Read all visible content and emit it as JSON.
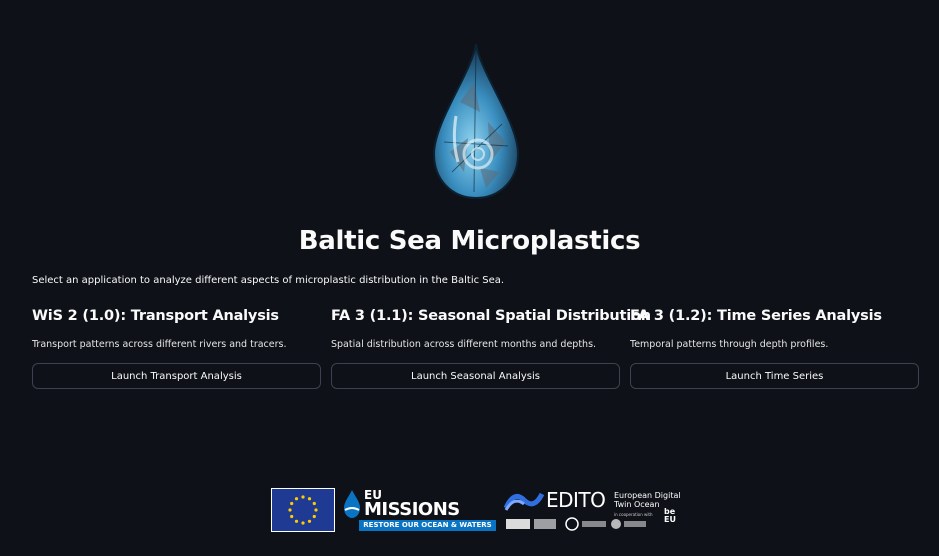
{
  "app": {
    "title": "Baltic Sea Microplastics",
    "intro": "Select an application to analyze different aspects of microplastic distribution in the Baltic Sea.",
    "hero_icon": "water-droplet-mosaic"
  },
  "apps": [
    {
      "heading": "WiS 2 (1.0): Transport Analysis",
      "description": "Transport patterns across different rivers and tracers.",
      "button": "Launch Transport Analysis"
    },
    {
      "heading": "FA 3 (1.1): Seasonal Spatial Distribution",
      "description": "Spatial distribution across different months and depths.",
      "button": "Launch Seasonal Analysis"
    },
    {
      "heading": "FA 3 (1.2): Time Series Analysis",
      "description": "Temporal patterns through depth profiles.",
      "button": "Launch Time Series"
    }
  ],
  "footer": {
    "missions_eu": "EU",
    "missions_word": "MISSIONS",
    "missions_tagline": "RESTORE OUR OCEAN & WATERS",
    "edito_word": "EDITO",
    "edito_sub1": "European Digital",
    "edito_sub2": "Twin Ocean",
    "edito_coop": "in cooperation with",
    "be_eu": "be EU"
  },
  "colors": {
    "background": "#0e1117",
    "button_border": "#3d4250",
    "eu_flag": "#1f3a93",
    "eu_stars": "#ffcc00",
    "missions_blue": "#0a74c4"
  }
}
